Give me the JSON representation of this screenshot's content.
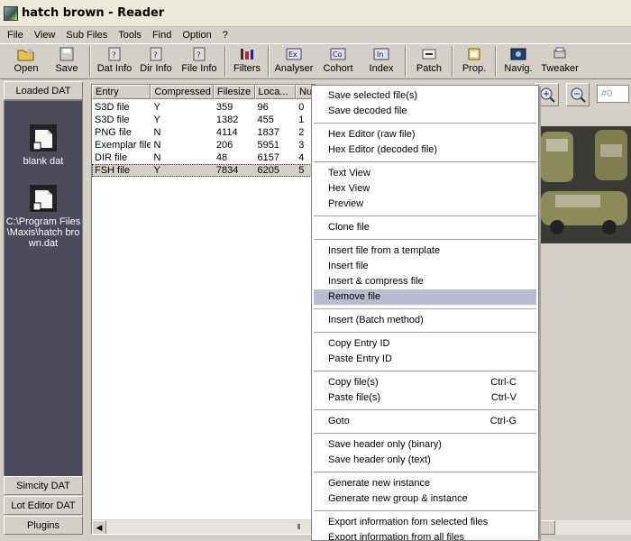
{
  "window": {
    "title": "hatch brown - Reader"
  },
  "menubar": [
    "File",
    "View",
    "Sub Files",
    "Tools",
    "Find",
    "Option",
    "?"
  ],
  "toolbar": [
    {
      "label": "Open",
      "icon": "open-folder-icon"
    },
    {
      "label": "Save",
      "icon": "save-disk-icon"
    },
    {
      "label": "Dat Info",
      "icon": "dat-info-icon"
    },
    {
      "label": "Dir Info",
      "icon": "dir-info-icon"
    },
    {
      "label": "File Info",
      "icon": "file-info-icon"
    },
    {
      "label": "Filters",
      "icon": "filters-icon"
    },
    {
      "label": "Analyser",
      "icon": "analyser-icon"
    },
    {
      "label": "Cohort",
      "icon": "cohort-icon"
    },
    {
      "label": "Index",
      "icon": "index-icon"
    },
    {
      "label": "Patch",
      "icon": "patch-icon"
    },
    {
      "label": "Prop.",
      "icon": "properties-icon"
    },
    {
      "label": "Navig.",
      "icon": "navigator-icon"
    },
    {
      "label": "Tweaker",
      "icon": "tweaker-icon"
    }
  ],
  "left_panel": {
    "top_tab": "Loaded DAT",
    "files": [
      "blank dat",
      "C:\\Program Files\\Maxis\\hatch brown.dat"
    ],
    "bottom_tabs": [
      "Simcity DAT",
      "Lot Editor DAT",
      "Plugins"
    ]
  },
  "table": {
    "columns": [
      "Entry",
      "Compressed",
      "Filesize",
      "Loca...",
      "Nu"
    ],
    "rows": [
      [
        "S3D file",
        "Y",
        "359",
        "96",
        "0"
      ],
      [
        "S3D file",
        "Y",
        "1382",
        "455",
        "1"
      ],
      [
        "PNG file",
        "N",
        "4114",
        "1837",
        "2"
      ],
      [
        "Exemplar file",
        "N",
        "206",
        "5951",
        "3"
      ],
      [
        "DIR file",
        "N",
        "48",
        "6157",
        "4"
      ],
      [
        "FSH file",
        "Y",
        "7834",
        "6205",
        "5"
      ]
    ],
    "selected_row": 5
  },
  "preview": {
    "index_placeholder": "#0"
  },
  "context_menu": [
    {
      "label": "Save selected file(s)"
    },
    {
      "label": "Save decoded file"
    },
    {
      "sep": true
    },
    {
      "label": "Hex Editor (raw file)"
    },
    {
      "label": "Hex Editor (decoded file)"
    },
    {
      "sep": true
    },
    {
      "label": "Text View"
    },
    {
      "label": "Hex View"
    },
    {
      "label": "Preview"
    },
    {
      "sep": true
    },
    {
      "label": "Clone file"
    },
    {
      "sep": true
    },
    {
      "label": "Insert file from a template"
    },
    {
      "label": "Insert file"
    },
    {
      "label": "Insert & compress file"
    },
    {
      "label": "Remove file",
      "highlighted": true
    },
    {
      "sep": true
    },
    {
      "label": "Insert (Batch method)"
    },
    {
      "sep": true
    },
    {
      "label": "Copy Entry ID"
    },
    {
      "label": "Paste Entry ID"
    },
    {
      "sep": true
    },
    {
      "label": "Copy file(s)",
      "shortcut": "Ctrl-C"
    },
    {
      "label": "Paste file(s)",
      "shortcut": "Ctrl-V"
    },
    {
      "sep": true
    },
    {
      "label": "Goto",
      "shortcut": "Ctrl-G"
    },
    {
      "sep": true
    },
    {
      "label": "Save header only (binary)"
    },
    {
      "label": "Save header only (text)"
    },
    {
      "sep": true
    },
    {
      "label": "Generate new instance"
    },
    {
      "label": "Generate new group & instance"
    },
    {
      "sep": true
    },
    {
      "label": "Export information fom selected files"
    },
    {
      "label": "Export information from all files"
    }
  ]
}
